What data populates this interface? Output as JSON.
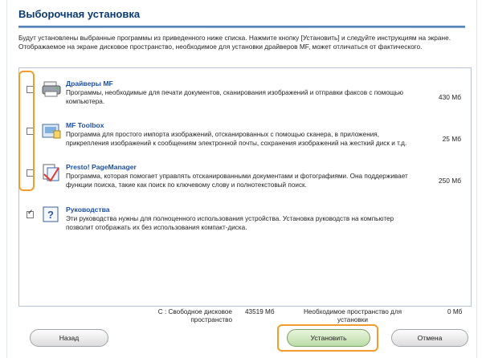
{
  "window": {
    "title": "Выборочная установка"
  },
  "intro": "Будут установлены выбранные программы из приведенного ниже списка. Нажмите кнопку [Установить] и следуйте инструкциям на экране. Отображаемое на экране дисковое пространство, необходимое для установки драйверов MF, может отличаться от фактического.",
  "items": [
    {
      "name": "Драйверы MF",
      "desc": "Программы, необходимые для печати документов, сканирования изображений и отправки факсов с помощью компьютера.",
      "size": "430 Мб",
      "checked": false,
      "icon": "printer-icon"
    },
    {
      "name": "MF Toolbox",
      "desc": "Программа для простого импорта изображений, отсканированных с помощью сканера, в приложения, прикрепления изображений к сообщениям электронной почты, сохранения изображений на жесткий диск и т.д.",
      "size": "25 Мб",
      "checked": false,
      "icon": "toolbox-icon"
    },
    {
      "name": "Presto! PageManager",
      "desc": "Программа, которая помогает управлять отсканированными документами и фотографиями. Она поддерживает функции поиска, такие как поиск по ключевому слову и полнотекстовый поиск.",
      "size": "250 Мб",
      "checked": false,
      "icon": "pagemanager-icon"
    },
    {
      "name": "Руководства",
      "desc": "Эти руководства нужны для полноценного использования устройства. Установка руководств на компьютер позволит отображать их без использования компакт-диска.",
      "size": "",
      "checked": true,
      "icon": "manuals-help-icon"
    }
  ],
  "status": {
    "free_label_1": "C : Свободное дисковое",
    "free_label_2": "пространство",
    "free_value": "43519 Мб",
    "required_label_1": "Необходимое пространство для",
    "required_label_2": "установки",
    "required_value": "0 Мб"
  },
  "buttons": {
    "back": "Назад",
    "install": "Установить",
    "cancel": "Отмена"
  },
  "colors": {
    "highlight": "#f29c2b",
    "title": "#0b3a73",
    "link": "#1d4fa8"
  }
}
